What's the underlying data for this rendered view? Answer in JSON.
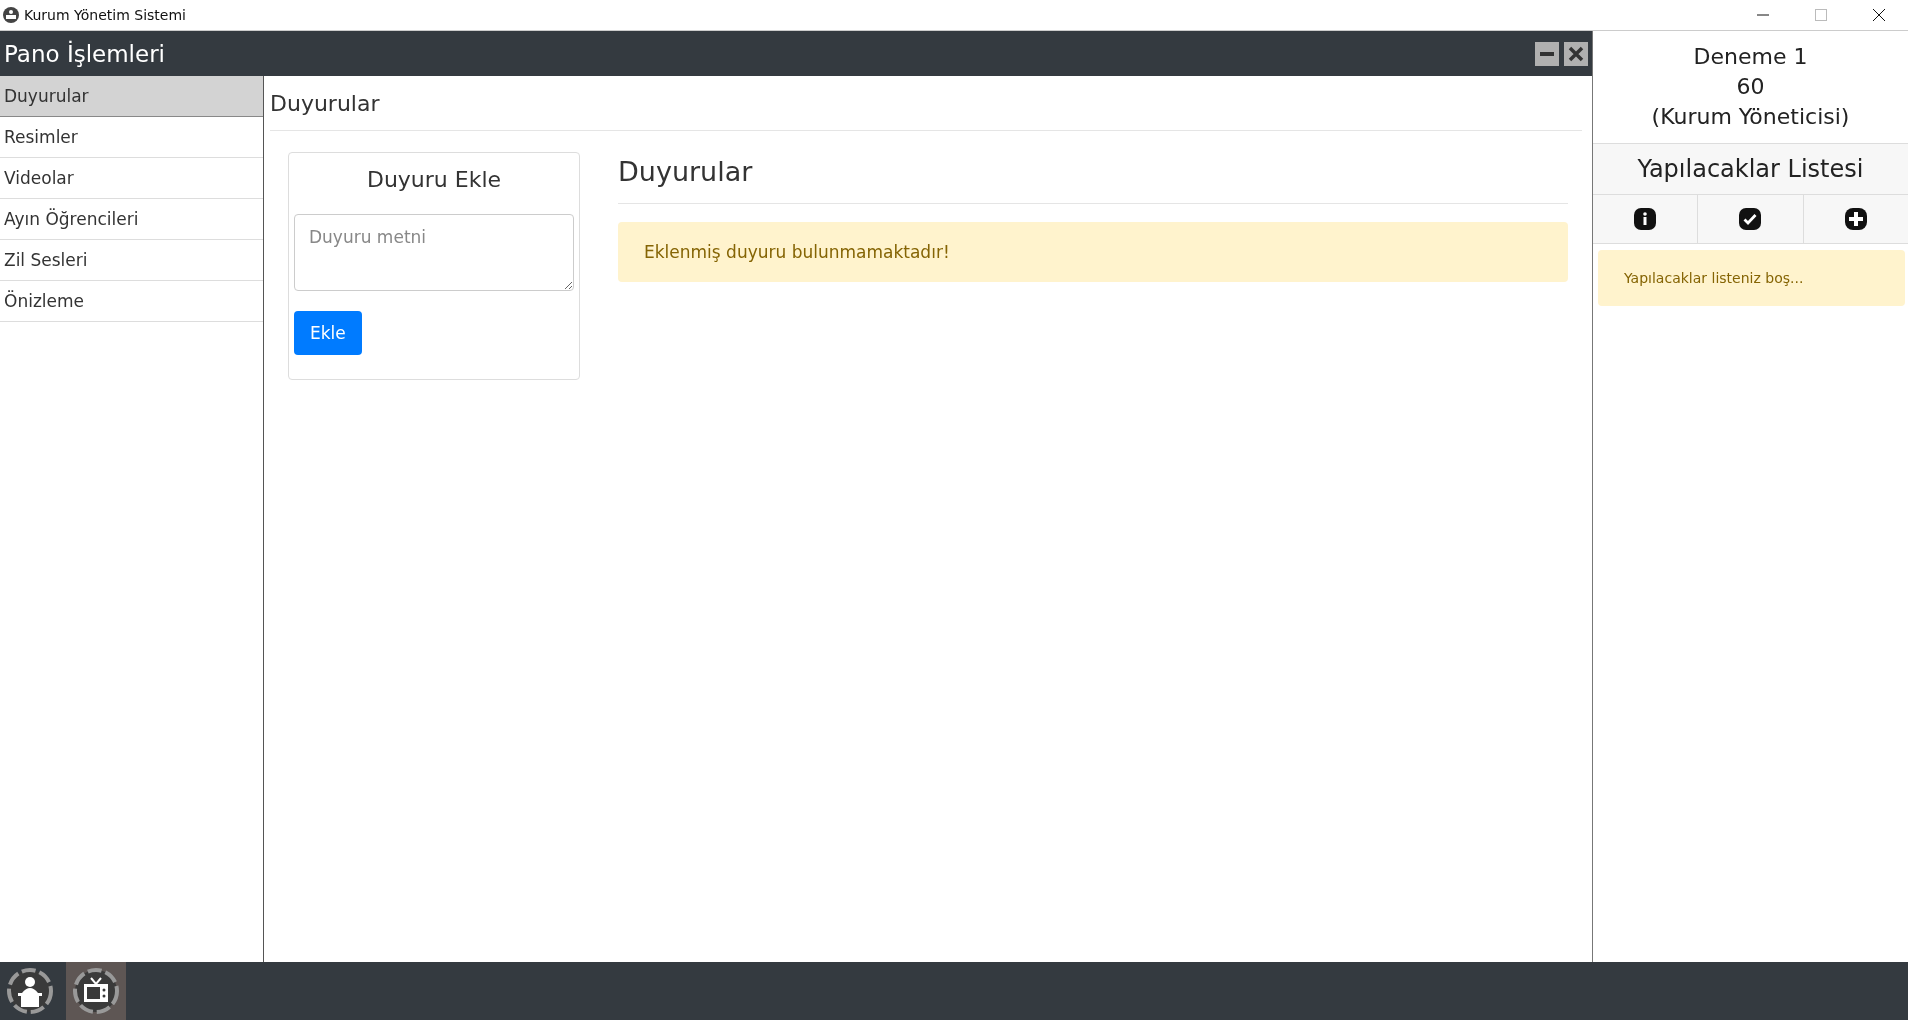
{
  "window": {
    "title": "Kurum Yönetim Sistemi"
  },
  "panel": {
    "title": "Pano İşlemleri"
  },
  "sidebar": {
    "items": [
      {
        "label": "Duyurular",
        "selected": true
      },
      {
        "label": "Resimler",
        "selected": false
      },
      {
        "label": "Videolar",
        "selected": false
      },
      {
        "label": "Ayın Öğrencileri",
        "selected": false
      },
      {
        "label": "Zil Sesleri",
        "selected": false
      },
      {
        "label": "Önizleme",
        "selected": false
      }
    ]
  },
  "content": {
    "heading": "Duyurular",
    "form": {
      "title": "Duyuru Ekle",
      "placeholder": "Duyuru metni",
      "button": "Ekle"
    },
    "list": {
      "title": "Duyurular",
      "alert": "Eklenmiş duyuru bulunmamaktadır!"
    }
  },
  "user": {
    "name": "Deneme 1",
    "number": "60",
    "role": "(Kurum Yöneticisi)"
  },
  "todo": {
    "title": "Yapılacaklar Listesi",
    "actions": [
      {
        "kind": "info"
      },
      {
        "kind": "check"
      },
      {
        "kind": "add"
      }
    ],
    "alert": "Yapılacaklar listeniz boş..."
  },
  "taskbar": {
    "items": [
      {
        "kind": "lectern",
        "selected": false
      },
      {
        "kind": "tv",
        "selected": true
      }
    ]
  }
}
